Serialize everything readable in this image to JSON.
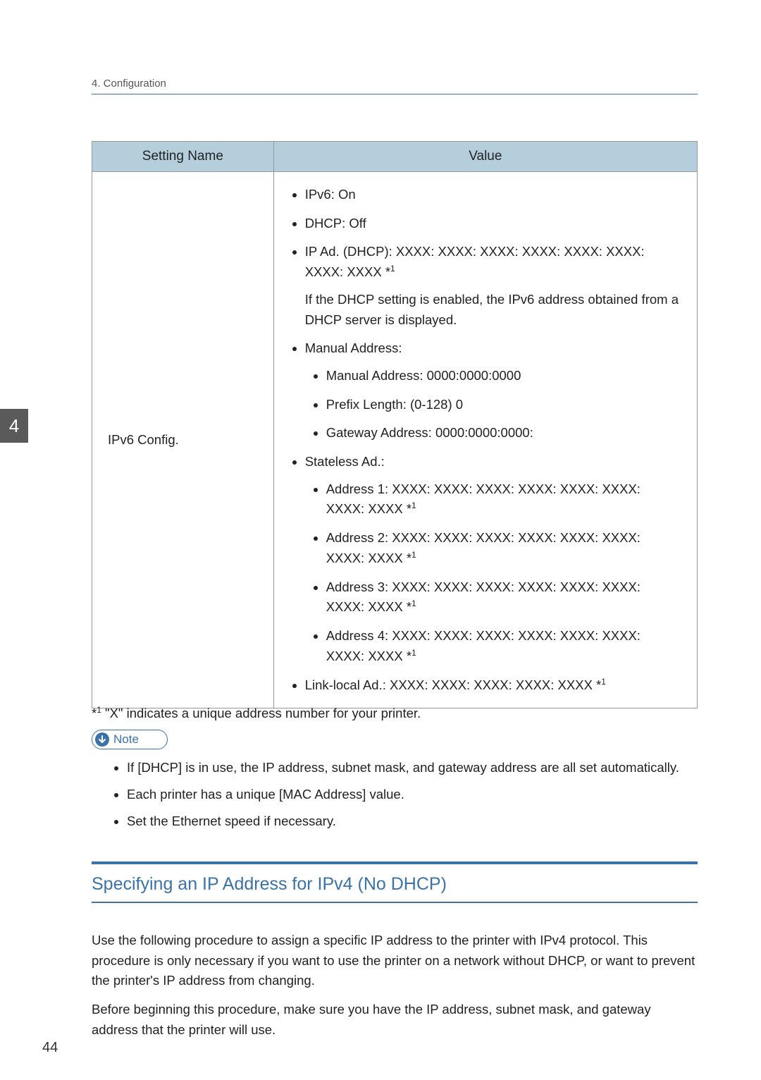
{
  "header": {
    "breadcrumb": "4. Configuration"
  },
  "sideTab": "4",
  "table": {
    "columns": {
      "setting": "Setting Name",
      "value": "Value"
    },
    "row": {
      "name": "IPv6 Config.",
      "items": {
        "ipv6": "IPv6: On",
        "dhcp": "DHCP: Off",
        "ipad": "IP Ad. (DHCP): XXXX: XXXX: XXXX: XXXX: XXXX: XXXX: XXXX: XXXX *",
        "ipad_sup": "1",
        "ipad_cond": "If the DHCP setting is enabled, the IPv6 address obtained from a DHCP server is displayed.",
        "manual_label": "Manual Address:",
        "manual_addr": "Manual Address: 0000:0000:0000",
        "prefix_len": "Prefix Length: (0-128) 0",
        "gateway": "Gateway Address: 0000:0000:0000:",
        "stateless_label": "Stateless Ad.:",
        "addr1": "Address 1: XXXX: XXXX: XXXX: XXXX: XXXX: XXXX: XXXX: XXXX *",
        "addr1_sup": "1",
        "addr2": "Address 2: XXXX: XXXX: XXXX: XXXX: XXXX: XXXX: XXXX: XXXX *",
        "addr2_sup": "1",
        "addr3": "Address 3: XXXX: XXXX: XXXX: XXXX: XXXX: XXXX: XXXX: XXXX *",
        "addr3_sup": "1",
        "addr4": "Address 4: XXXX: XXXX: XXXX: XXXX: XXXX: XXXX: XXXX: XXXX *",
        "addr4_sup": "1",
        "linklocal": "Link-local Ad.: XXXX: XXXX: XXXX: XXXX: XXXX *",
        "linklocal_sup": "1"
      }
    }
  },
  "footnote": {
    "marker": "*",
    "sup": "1",
    "text": " \"X\" indicates a unique address number for your printer."
  },
  "noteBadge": {
    "label": "Note"
  },
  "notes": {
    "n1": "If [DHCP] is in use, the IP address, subnet mask, and gateway address are all set automatically.",
    "n2": "Each printer has a unique [MAC Address] value.",
    "n3": "Set the Ethernet speed if necessary."
  },
  "section": {
    "title": "Specifying an IP Address for IPv4 (No DHCP)"
  },
  "paras": {
    "p1": "Use the following procedure to assign a specific IP address to the printer with IPv4 protocol. This procedure is only necessary if you want to use the printer on a network without DHCP, or want to prevent the printer's IP address from changing.",
    "p2": "Before beginning this procedure, make sure you have the IP address, subnet mask, and gateway address that the printer will use."
  },
  "pageNumber": "44"
}
